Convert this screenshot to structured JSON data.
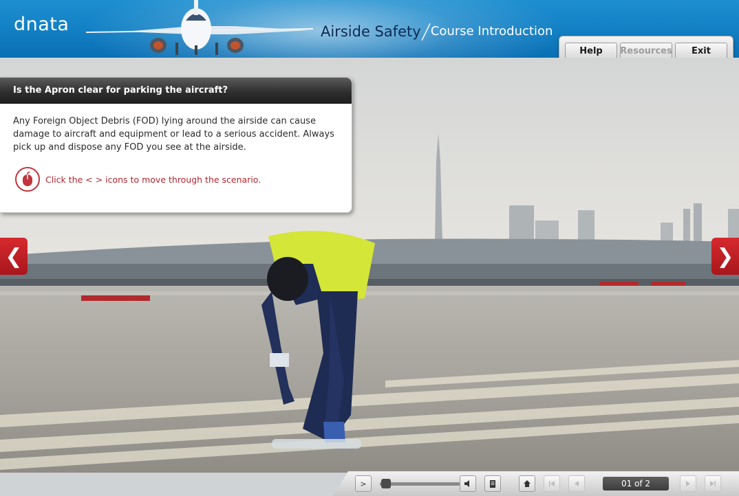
{
  "header": {
    "logo": "dnata",
    "title": "Airside Safety",
    "subtitle": "Course Introduction"
  },
  "top_buttons": {
    "help": "Help",
    "resources": "Resources",
    "exit": "Exit"
  },
  "panel": {
    "heading": "Is the Apron clear for parking the aircraft?",
    "body": "Any Foreign Object Debris (FOD) lying around the airside can cause damage to aircraft and equipment or lead to a serious accident. Always pick up and dispose any FOD you see at the airside.",
    "hint": "Click the < > icons to move through the scenario."
  },
  "nav": {
    "prev_glyph": "❮",
    "next_glyph": "❯"
  },
  "player": {
    "play_glyph": ">",
    "page_indicator": "01 of 2",
    "progress": 0.0
  },
  "colors": {
    "header_blue": "#1482c6",
    "accent_red": "#c0343b",
    "panel_head": "#2f2f2f"
  }
}
